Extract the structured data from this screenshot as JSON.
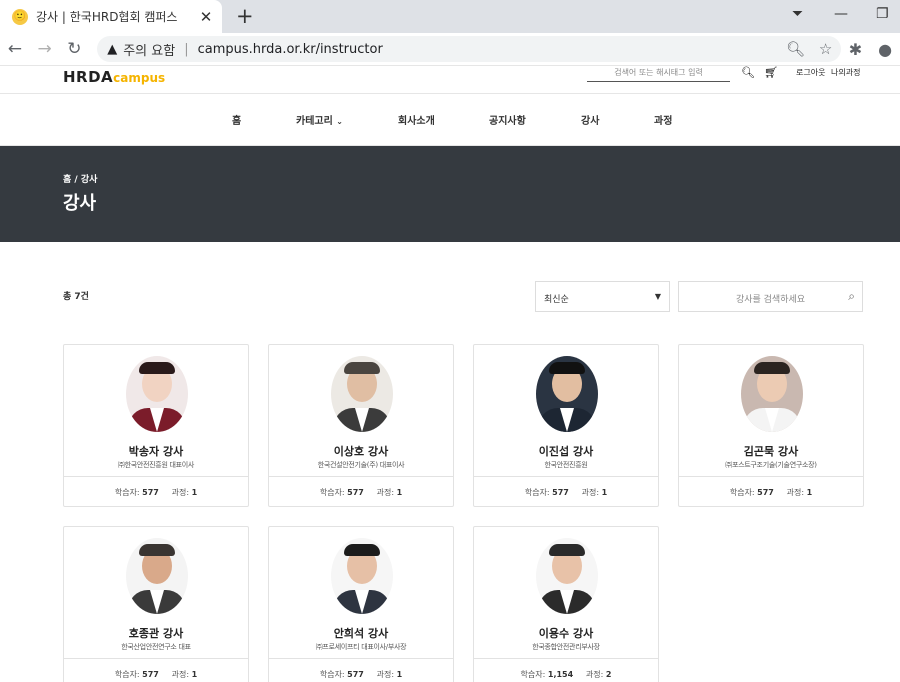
{
  "browser": {
    "tab_title": "강사 | 한국HRD협회 캠퍼스",
    "favicon": "🙂",
    "security_label": "주의 요함",
    "url": "campus.hrda.or.kr/instructor"
  },
  "header": {
    "logo_main": "HRDA",
    "logo_sub": "campus",
    "search_placeholder": "검색어 또는 해시태그 입력",
    "logout": "로그아웃",
    "mypage": "나의과정"
  },
  "nav": {
    "home": "홈",
    "category": "카테고리",
    "company": "회사소개",
    "notice": "공지사항",
    "instructor": "강사",
    "course": "과정"
  },
  "banner": {
    "crumb_home": "홈",
    "crumb_sep": "/",
    "crumb_current": "강사",
    "title": "강사"
  },
  "listing": {
    "total": "총 7건",
    "sort_selected": "최신순",
    "search_placeholder": "강사를 검색하세요",
    "learners_label": "학습자:",
    "courses_label": "과정:"
  },
  "instructors": [
    {
      "name": "박송자 강사",
      "org": "㈜한국안전진흥원 대표이사",
      "learners": "577",
      "courses": "1"
    },
    {
      "name": "이상호 강사",
      "org": "한국건설안전기술(주) 대표이사",
      "learners": "577",
      "courses": "1"
    },
    {
      "name": "이진섭 강사",
      "org": "한국안전진흥원",
      "learners": "577",
      "courses": "1"
    },
    {
      "name": "김곤묵 강사",
      "org": "㈜포스트구조기술(기술연구소장)",
      "learners": "577",
      "courses": "1"
    },
    {
      "name": "호종관 강사",
      "org": "한국산업안전연구소 대표",
      "learners": "577",
      "courses": "1"
    },
    {
      "name": "안희석 강사",
      "org": "㈜프로세이프티 대표이사/부사장",
      "learners": "577",
      "courses": "1"
    },
    {
      "name": "이용수 강사",
      "org": "한국종합안전관리부사장",
      "learners": "1,154",
      "courses": "2"
    }
  ]
}
